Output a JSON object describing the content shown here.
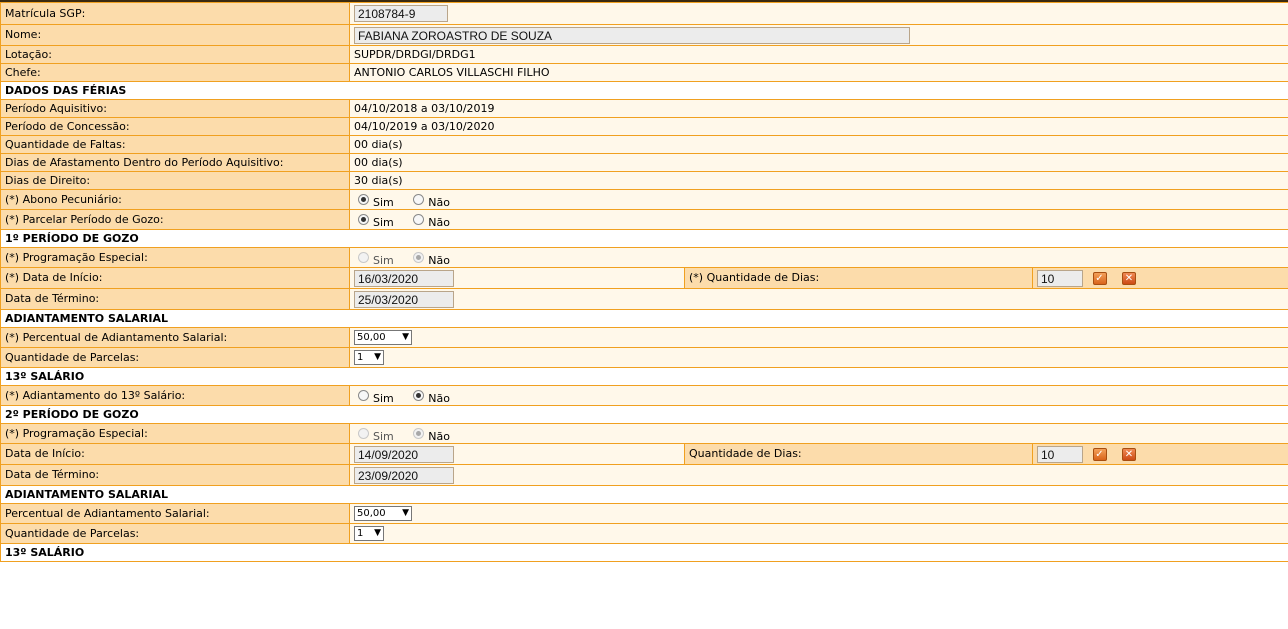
{
  "identification": {
    "matricula_label": "Matrícula SGP:",
    "matricula_value": "2108784-9",
    "nome_label": "Nome:",
    "nome_value": "FABIANA ZOROASTRO DE SOUZA",
    "lotacao_label": "Lotação:",
    "lotacao_value": "SUPDR/DRDGI/DRDG1",
    "chefe_label": "Chefe:",
    "chefe_value": "ANTONIO CARLOS VILLASCHI FILHO"
  },
  "ferias": {
    "section_title": "DADOS DAS FÉRIAS",
    "aquisitivo_label": "Período Aquisitivo:",
    "aquisitivo_value": "04/10/2018  a  03/10/2019",
    "concessao_label": "Período de Concessão:",
    "concessao_value": "04/10/2019  a  03/10/2020",
    "faltas_label": "Quantidade de Faltas:",
    "faltas_value": "00  dia(s)",
    "afastamento_label": "Dias de Afastamento Dentro do Período Aquisitivo:",
    "afastamento_value": "00  dia(s)",
    "direito_label": "Dias de Direito:",
    "direito_value": "30  dia(s)",
    "abono_label": "(*) Abono Pecuniário:",
    "parcelar_label": "(*) Parcelar Período de Gozo:"
  },
  "radio_labels": {
    "sim": "Sim",
    "nao": "Não"
  },
  "periodo1": {
    "section_title": "1º PERÍODO DE GOZO",
    "prog_label": "(*) Programação Especial:",
    "inicio_label": "(*) Data de Início:",
    "inicio_value": "16/03/2020",
    "qtd_label": "(*) Quantidade de Dias:",
    "qtd_value": "10",
    "termino_label": "Data de Término:",
    "termino_value": "25/03/2020",
    "adiant_title": "ADIANTAMENTO SALARIAL",
    "perc_label": "(*) Percentual de Adiantamento Salarial:",
    "perc_value": "50,00",
    "parcelas_label": "Quantidade de Parcelas:",
    "parcelas_value": "1",
    "decimo_title": "13º SALÁRIO",
    "decimo_label": "(*) Adiantamento do 13º Salário:"
  },
  "periodo2": {
    "section_title": "2º PERÍODO DE GOZO",
    "prog_label": "(*) Programação Especial:",
    "inicio_label": "Data de Início:",
    "inicio_value": "14/09/2020",
    "qtd_label": "Quantidade de Dias:",
    "qtd_value": "10",
    "termino_label": "Data de Término:",
    "termino_value": "23/09/2020",
    "adiant_title": "ADIANTAMENTO SALARIAL",
    "perc_label": "Percentual de Adiantamento Salarial:",
    "perc_value": "50,00",
    "parcelas_label": "Quantidade de Parcelas:",
    "parcelas_value": "1",
    "decimo_title": "13º SALÁRIO"
  },
  "icons": {
    "confirm": "check-icon",
    "cancel": "close-icon"
  },
  "colors": {
    "label_bg": "#fcdcab",
    "value_bg": "#fff8ea",
    "border": "#f0a020"
  }
}
